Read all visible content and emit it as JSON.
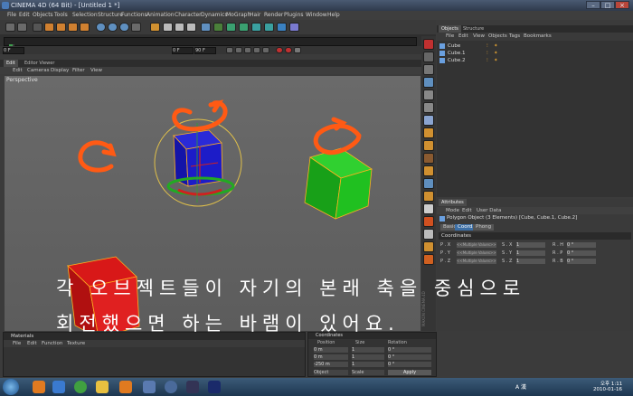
{
  "window": {
    "title": "CINEMA 4D (64 Bit) - [Untitled 1 *]"
  },
  "menubar": [
    "File",
    "Edit",
    "Objects",
    "Tools",
    "Selection",
    "Structure",
    "Functions",
    "Animation",
    "Character",
    "Dynamics",
    "MoGraph",
    "Hair",
    "Render",
    "Plugins",
    "Window",
    "Help"
  ],
  "timeline": {
    "start_field": "0 F",
    "frame_field": "0 F",
    "end_field": "90 F"
  },
  "viewport": {
    "tabs": [
      "Edit",
      "Editor Viewer"
    ],
    "menu": [
      "Edit",
      "Cameras",
      "Display",
      "Filter",
      "View"
    ],
    "label": "Perspective"
  },
  "object_manager": {
    "tabs": [
      "Objects",
      "Structure"
    ],
    "menu": [
      "File",
      "Edit",
      "View",
      "Objects",
      "Tags",
      "Bookmarks"
    ],
    "items": [
      "Cube",
      "Cube.1",
      "Cube.2"
    ]
  },
  "attribute_manager": {
    "tab": "Attributes",
    "menu": [
      "Mode",
      "Edit",
      "User Data"
    ],
    "title": "Polygon Object (3 Elements) [Cube, Cube.1, Cube.2]",
    "subtabs": [
      "Basic",
      "Coord.",
      "Phong"
    ],
    "section": "Coordinates",
    "rows": [
      {
        "p": "P . X",
        "pv": "<<Multiple Values>>",
        "s": "S . X",
        "sv": "1",
        "r": "R . H",
        "rv": "0 °"
      },
      {
        "p": "P . Y",
        "pv": "<<Multiple Values>>",
        "s": "S . Y",
        "sv": "1",
        "r": "R . P",
        "rv": "0 °"
      },
      {
        "p": "P . Z",
        "pv": "<<Multiple Values>>",
        "s": "S . Z",
        "sv": "1",
        "r": "R . B",
        "rv": "0 °"
      }
    ],
    "side_logo": "MAXON CINEMA 4D"
  },
  "materials": {
    "title": "Materials",
    "menu": [
      "File",
      "Edit",
      "Function",
      "Texture"
    ]
  },
  "coordinates": {
    "title": "Coordinates",
    "headers": [
      "Position",
      "Size",
      "Rotation"
    ],
    "rows": [
      {
        "pos": "0 m",
        "size": "1",
        "rot": "0 °"
      },
      {
        "pos": "0 m",
        "size": "1",
        "rot": "0 °"
      },
      {
        "pos": "-250 m",
        "size": "1",
        "rot": "0 °"
      }
    ],
    "dropdowns": [
      "Object",
      "Scale"
    ],
    "apply_label": "Apply"
  },
  "overlay_text": {
    "line1": "각 오브젝트들이 자기의 본래 축을 중심으로",
    "line2": "회전했으면 하는 바램이 있어요."
  },
  "taskbar": {
    "ime": "A 漢",
    "time": "오후 1:11",
    "date": "2010-01-16"
  },
  "colors": {
    "cube_left": "#c81010",
    "cube_mid": "#1010c0",
    "cube_right": "#18b018",
    "arrow": "#ff5a14",
    "accent": "#f0a020"
  }
}
